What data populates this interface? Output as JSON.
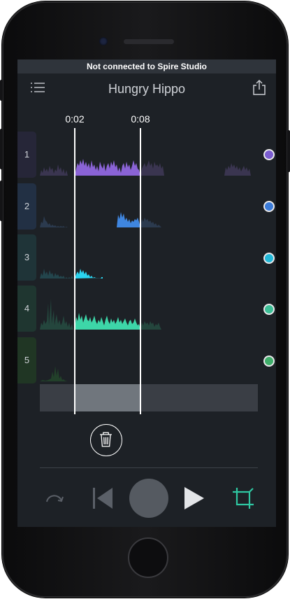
{
  "banner": {
    "text": "Not connected to Spire Studio"
  },
  "header": {
    "title": "Hungry Hippo",
    "menu_icon": "list-icon",
    "share_icon": "share-icon"
  },
  "selection": {
    "start_label": "0:02",
    "end_label": "0:08"
  },
  "tracks": [
    {
      "number": "1",
      "color": "#7a5ccf"
    },
    {
      "number": "2",
      "color": "#3b7bd8"
    },
    {
      "number": "3",
      "color": "#22b8d8"
    },
    {
      "number": "4",
      "color": "#3cbf96"
    },
    {
      "number": "5",
      "color": "#3fae6a"
    }
  ],
  "actions": {
    "delete_icon": "trash-icon"
  },
  "transport": {
    "redo_icon": "redo-icon",
    "previous_icon": "skip-back-icon",
    "record_icon": "record-button",
    "play_icon": "play-icon",
    "crop_icon": "crop-icon"
  }
}
